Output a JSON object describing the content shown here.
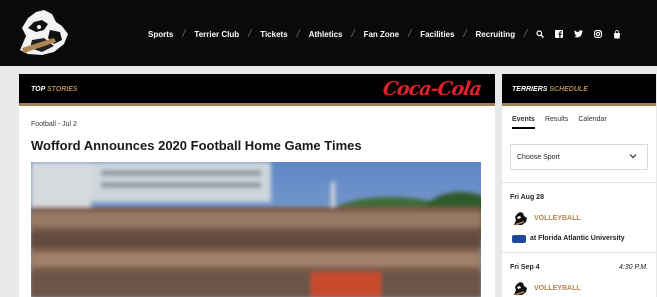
{
  "nav": {
    "items": [
      "Sports",
      "Terrier Club",
      "Tickets",
      "Athletics",
      "Fan Zone",
      "Facilities",
      "Recruiting"
    ],
    "icons": [
      "search-icon",
      "facebook-icon",
      "twitter-icon",
      "instagram-icon",
      "store-icon"
    ]
  },
  "top_stories": {
    "title_prefix": "TOP",
    "title_accent": "STORIES",
    "sponsor": "Coca-Cola",
    "kicker": "Football - Jul 2",
    "headline": "Wofford Announces 2020 Football Home Game Times"
  },
  "schedule": {
    "title_prefix": "TERRIERS",
    "title_accent": "SCHEDULE",
    "tabs": [
      "Events",
      "Results",
      "Calendar"
    ],
    "active_tab": "Events",
    "select_value": "Choose Sport",
    "events": [
      {
        "date": "Fri Aug 28",
        "time": "",
        "sport": "VOLLEYBALL",
        "opponent": "at Florida Atlantic University"
      },
      {
        "date": "Fri Sep 4",
        "time": "4:30 P.M.",
        "sport": "VOLLEYBALL",
        "opponent": ""
      }
    ]
  },
  "colors": {
    "accent": "#b08552",
    "coke_red": "#e0202a",
    "bar": "#0a0a0a"
  }
}
